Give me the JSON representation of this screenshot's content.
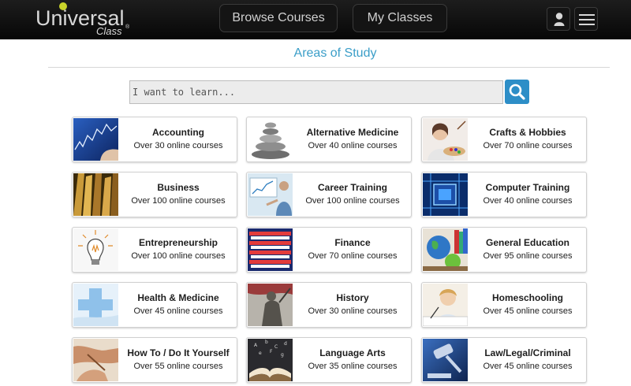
{
  "header": {
    "logo_main": "Universal",
    "logo_sub": "Class",
    "logo_reg": "®",
    "nav": [
      "Browse Courses",
      "My Classes"
    ],
    "icons": [
      "user-icon",
      "hamburger-menu-icon"
    ],
    "colors": {
      "bar": "#0a0a0a",
      "nav_text": "#d0d0d0",
      "logo_bulb": "#c9d32a"
    }
  },
  "main": {
    "title": "Areas of Study",
    "title_color": "#3b9ec8",
    "search": {
      "placeholder": "I want to learn...",
      "value": "",
      "button_icon": "search-icon",
      "button_color": "#2d8ec7"
    },
    "categories": [
      {
        "name": "Accounting",
        "count": "Over 30 online courses",
        "thumb": "stock-chart"
      },
      {
        "name": "Alternative Medicine",
        "count": "Over 40 online courses",
        "thumb": "stacked-stones"
      },
      {
        "name": "Crafts & Hobbies",
        "count": "Over 70 online courses",
        "thumb": "painter"
      },
      {
        "name": "Business",
        "count": "Over 100 online courses",
        "thumb": "gold-skyscrapers"
      },
      {
        "name": "Career Training",
        "count": "Over 100 online courses",
        "thumb": "presenter"
      },
      {
        "name": "Computer Training",
        "count": "Over 40 online courses",
        "thumb": "circuit-chip"
      },
      {
        "name": "Entrepreneurship",
        "count": "Over 100 online courses",
        "thumb": "light-bulb"
      },
      {
        "name": "Finance",
        "count": "Over 70 online courses",
        "thumb": "stock-ticker"
      },
      {
        "name": "General Education",
        "count": "Over 95 online courses",
        "thumb": "globe-apple"
      },
      {
        "name": "Health & Medicine",
        "count": "Over 45 online courses",
        "thumb": "medical-cross"
      },
      {
        "name": "History",
        "count": "Over 30 online courses",
        "thumb": "soldier-statue"
      },
      {
        "name": "Homeschooling",
        "count": "Over 45 online courses",
        "thumb": "child-writing"
      },
      {
        "name": "How To / Do It Yourself",
        "count": "Over 55 online courses",
        "thumb": "hands-working"
      },
      {
        "name": "Language Arts",
        "count": "Over 35 online courses",
        "thumb": "open-book"
      },
      {
        "name": "Law/Legal/Criminal",
        "count": "Over 45 online courses",
        "thumb": "gavel"
      }
    ]
  }
}
